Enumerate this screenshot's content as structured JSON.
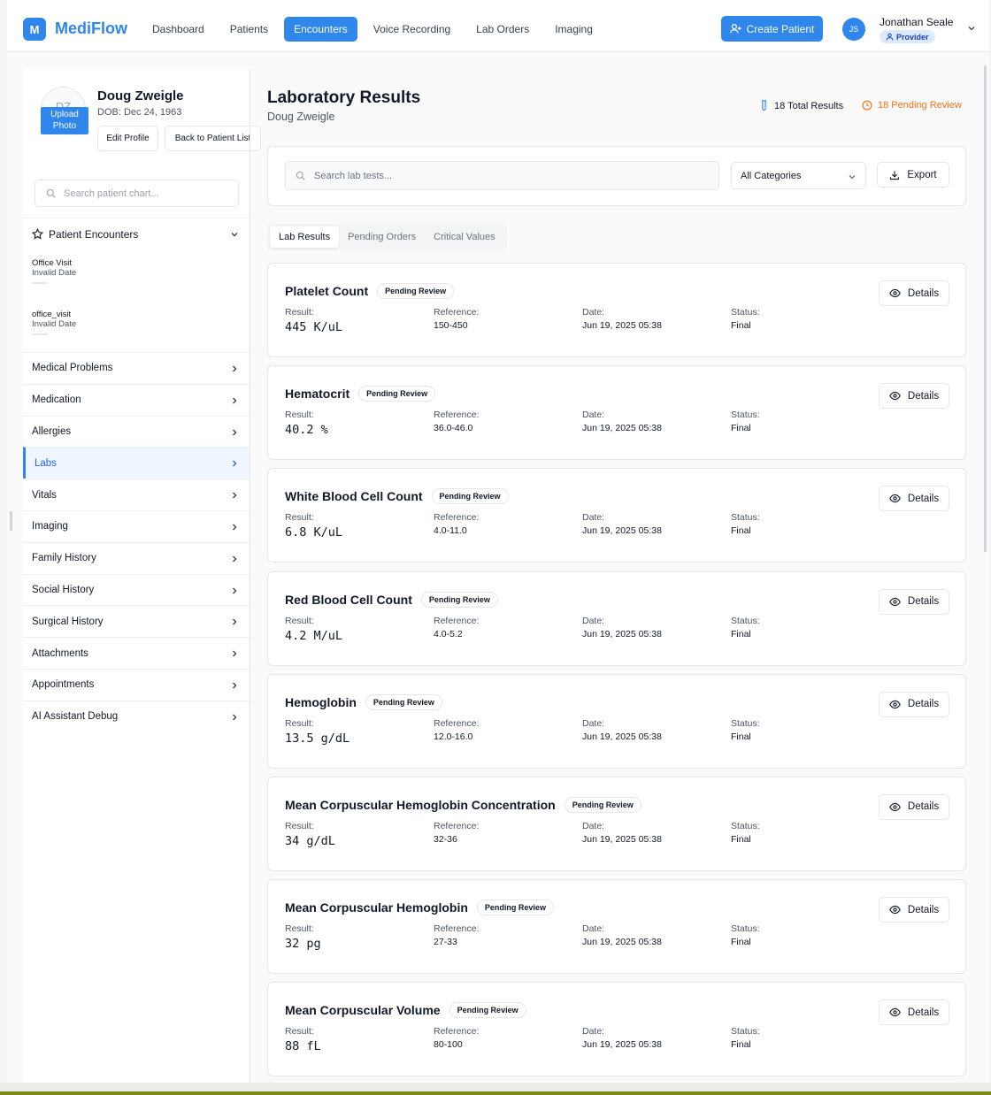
{
  "app": {
    "logo_letter": "M",
    "name": "MediFlow",
    "accent": "#2f86eb"
  },
  "nav": {
    "items": [
      {
        "label": "Dashboard"
      },
      {
        "label": "Patients"
      },
      {
        "label": "Encounters",
        "active": true
      },
      {
        "label": "Voice Recording"
      },
      {
        "label": "Lab Orders"
      },
      {
        "label": "Imaging"
      }
    ],
    "create_patient": "Create Patient",
    "user_initials": "JS",
    "user_name": "Jonathan Seale",
    "user_role": "Provider"
  },
  "patient": {
    "initials": "DZ",
    "upload_label": "Upload Photo",
    "name": "Doug Zweigle",
    "dob": "DOB: Dec 24, 1963",
    "edit_label": "Edit Profile",
    "back_label": "Back to Patient List"
  },
  "sidebar": {
    "search_placeholder": "Search patient chart...",
    "encounters_heading": "Patient Encounters",
    "encounters": [
      {
        "title": "Office Visit",
        "date": "Invalid Date"
      },
      {
        "title": "office_visit",
        "date": "Invalid Date"
      }
    ],
    "menu": [
      {
        "label": "Medical Problems"
      },
      {
        "label": "Medication"
      },
      {
        "label": "Allergies"
      },
      {
        "label": "Labs",
        "active": true
      },
      {
        "label": "Vitals"
      },
      {
        "label": "Imaging"
      },
      {
        "label": "Family History"
      },
      {
        "label": "Social History"
      },
      {
        "label": "Surgical History"
      },
      {
        "label": "Attachments"
      },
      {
        "label": "Appointments"
      },
      {
        "label": "AI Assistant Debug"
      }
    ]
  },
  "labs": {
    "title": "Laboratory Results",
    "subtitle": "Doug Zweigle",
    "total_results": "18 Total Results",
    "pending_review": "18 Pending Review",
    "search_placeholder": "Search lab tests...",
    "category_selected": "All Categories",
    "export_label": "Export",
    "tabs": [
      {
        "label": "Lab Results",
        "active": true
      },
      {
        "label": "Pending Orders"
      },
      {
        "label": "Critical Values"
      }
    ],
    "field_labels": {
      "result": "Result:",
      "reference": "Reference:",
      "date": "Date:",
      "status": "Status:"
    },
    "details_label": "Details",
    "badge_label": "Pending Review",
    "results": [
      {
        "name": "Platelet Count",
        "result": "445 K/uL",
        "reference": "150-450",
        "date": "Jun 19, 2025 05:38",
        "status": "Final"
      },
      {
        "name": "Hematocrit",
        "result": "40.2 %",
        "reference": "36.0-46.0",
        "date": "Jun 19, 2025 05:38",
        "status": "Final"
      },
      {
        "name": "White Blood Cell Count",
        "result": "6.8 K/uL",
        "reference": "4.0-11.0",
        "date": "Jun 19, 2025 05:38",
        "status": "Final"
      },
      {
        "name": "Red Blood Cell Count",
        "result": "4.2 M/uL",
        "reference": "4.0-5.2",
        "date": "Jun 19, 2025 05:38",
        "status": "Final"
      },
      {
        "name": "Hemoglobin",
        "result": "13.5 g/dL",
        "reference": "12.0-16.0",
        "date": "Jun 19, 2025 05:38",
        "status": "Final"
      },
      {
        "name": "Mean Corpuscular Hemoglobin Concentration",
        "result": "34 g/dL",
        "reference": "32-36",
        "date": "Jun 19, 2025 05:38",
        "status": "Final"
      },
      {
        "name": "Mean Corpuscular Hemoglobin",
        "result": "32 pg",
        "reference": "27-33",
        "date": "Jun 19, 2025 05:38",
        "status": "Final"
      },
      {
        "name": "Mean Corpuscular Volume",
        "result": "88 fL",
        "reference": "80-100",
        "date": "Jun 19, 2025 05:38",
        "status": "Final"
      }
    ]
  },
  "colors": {
    "pending": "#f97316",
    "badge_bg": "#dbeafe"
  }
}
